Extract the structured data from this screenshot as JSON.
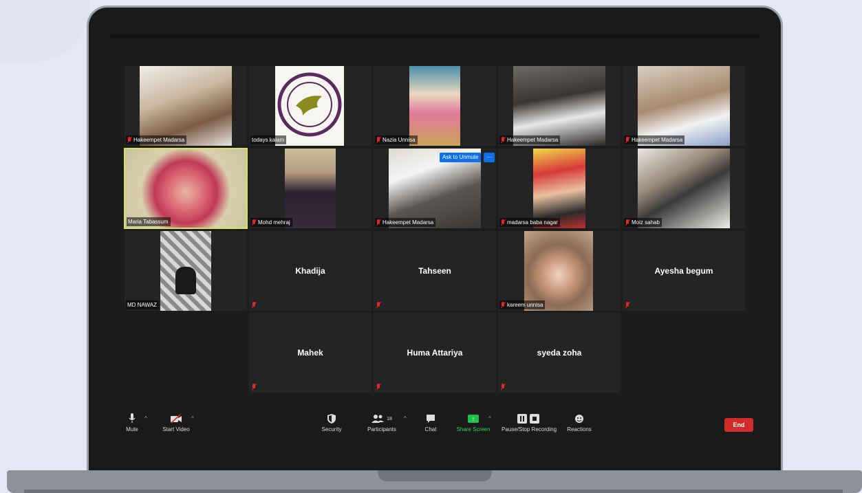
{
  "participants": [
    {
      "name": "Hakeempet Madarsa"
    },
    {
      "name": "todays kalam"
    },
    {
      "name": "Nazia Unnisa"
    },
    {
      "name": "Hakeempet Madarsa"
    },
    {
      "name": "Hakeempet Madarsa"
    },
    {
      "name": "Maria Tabassum"
    },
    {
      "name": "Mohd mehraj"
    },
    {
      "name": "Hakeempet Madarsa"
    },
    {
      "name": "madarsa baba nagar"
    },
    {
      "name": "Moiz sahab"
    },
    {
      "name": "MD NAWAZ"
    },
    {
      "name": "Khadija"
    },
    {
      "name": "Tahseen"
    },
    {
      "name": "kareem unnisa"
    },
    {
      "name": "Ayesha begum"
    },
    {
      "name": "Mahek"
    },
    {
      "name": "Huma Attariya"
    },
    {
      "name": "syeda zoha"
    }
  ],
  "overlay": {
    "ask_to_unmute": "Ask to Unmute",
    "more": "···"
  },
  "toolbar": {
    "mute": "Mute",
    "start_video": "Start Video",
    "security": "Security",
    "participants": "Participants",
    "participants_count": "18",
    "chat": "Chat",
    "share_screen": "Share Screen",
    "recording": "Pause/Stop Recording",
    "reactions": "Reactions",
    "end": "End"
  },
  "colors": {
    "active_speaker": "#d7e35a",
    "end": "#d12b2b",
    "share": "#1fbf4a",
    "muted": "#e02828",
    "ask_unmute": "#0e71eb"
  }
}
